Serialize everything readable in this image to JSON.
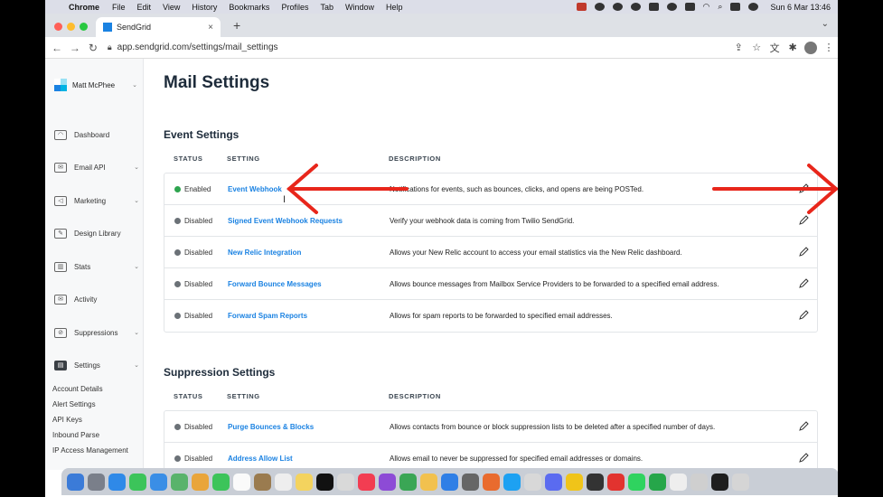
{
  "menubar": {
    "items": [
      "Chrome",
      "File",
      "Edit",
      "View",
      "History",
      "Bookmarks",
      "Profiles",
      "Tab",
      "Window",
      "Help"
    ],
    "clock": "Sun 6 Mar  13:46"
  },
  "browser": {
    "tab_title": "SendGrid",
    "url": "app.sendgrid.com/settings/mail_settings"
  },
  "sidebar": {
    "account_name": "Matt McPhee",
    "items": [
      {
        "label": "Dashboard",
        "icon": "gauge-icon",
        "expandable": false
      },
      {
        "label": "Email API",
        "icon": "envelope-icon",
        "expandable": true
      },
      {
        "label": "Marketing",
        "icon": "megaphone-icon",
        "expandable": true
      },
      {
        "label": "Design Library",
        "icon": "design-icon",
        "expandable": false
      },
      {
        "label": "Stats",
        "icon": "bar-chart-icon",
        "expandable": true
      },
      {
        "label": "Activity",
        "icon": "activity-icon",
        "expandable": false
      },
      {
        "label": "Suppressions",
        "icon": "block-icon",
        "expandable": true
      },
      {
        "label": "Settings",
        "icon": "settings-icon",
        "expandable": true
      }
    ],
    "settings_sublinks": [
      "Account Details",
      "Alert Settings",
      "API Keys",
      "Inbound Parse",
      "IP Access Management"
    ]
  },
  "main": {
    "title": "Mail Settings",
    "columns": {
      "status": "STATUS",
      "setting": "SETTING",
      "description": "DESCRIPTION"
    },
    "event_settings": {
      "heading": "Event Settings",
      "rows": [
        {
          "status": "Enabled",
          "setting": "Event Webhook",
          "description": "Notifications for events, such as bounces, clicks, and opens are being POSTed."
        },
        {
          "status": "Disabled",
          "setting": "Signed Event Webhook Requests",
          "description": "Verify your webhook data is coming from Twilio SendGrid."
        },
        {
          "status": "Disabled",
          "setting": "New Relic Integration",
          "description": "Allows your New Relic account to access your email statistics via the New Relic dashboard."
        },
        {
          "status": "Disabled",
          "setting": "Forward Bounce Messages",
          "description": "Allows bounce messages from Mailbox Service Providers to be forwarded to a specified email address."
        },
        {
          "status": "Disabled",
          "setting": "Forward Spam Reports",
          "description": "Allows for spam reports to be forwarded to specified email addresses."
        }
      ]
    },
    "suppression_settings": {
      "heading": "Suppression Settings",
      "rows": [
        {
          "status": "Disabled",
          "setting": "Purge Bounces & Blocks",
          "description": "Allows contacts from bounce or block suppression lists to be deleted after a specified number of days."
        },
        {
          "status": "Disabled",
          "setting": "Address Allow List",
          "description": "Allows email to never be suppressed for specified email addresses or domains."
        }
      ]
    }
  },
  "colors": {
    "enabled": "#2ea44f",
    "disabled": "#6b7177",
    "link": "#1a82e2",
    "annotation_arrow": "#e8261b"
  }
}
